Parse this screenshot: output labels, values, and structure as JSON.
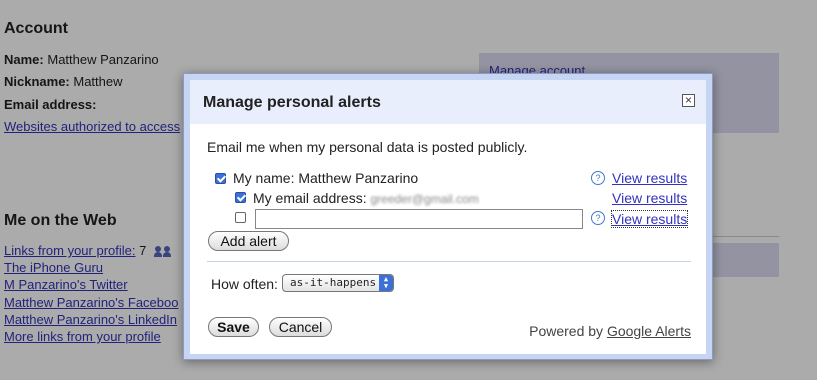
{
  "background": {
    "account_heading": "Account",
    "name_label": "Name:",
    "name_value": "Matthew Panzarino",
    "nickname_label": "Nickname:",
    "nickname_value": "Matthew",
    "email_label": "Email address:",
    "websites_link": "Websites authorized to access",
    "manage_account_link": "Manage account",
    "web_heading": "Me on the Web",
    "links_from_profile": "Links from your profile:",
    "links_count": "7",
    "profile_links": [
      "The iPhone Guru",
      "M Panzarino's Twitter",
      "Matthew Panzarino's Faceboo",
      "Matthew Panzarino's LinkedIn"
    ],
    "more_links": "More links from your profile"
  },
  "dialog": {
    "title": "Manage personal alerts",
    "close_glyph": "×",
    "intro": "Email me when my personal data is posted publicly.",
    "options": [
      {
        "label": "My name: Matthew Panzarino",
        "checked": true,
        "view": "View results"
      },
      {
        "label": "My email address:",
        "blurred_value": "greeder@gmail.com",
        "checked": true,
        "view": "View results"
      },
      {
        "label": "",
        "checked": false,
        "view": "View results"
      }
    ],
    "add_alert_button": "Add alert",
    "how_often_label": "How often:",
    "how_often_value": "as-it-happens",
    "save_button": "Save",
    "cancel_button": "Cancel",
    "powered_by": "Powered by",
    "powered_link": "Google Alerts",
    "help_glyph": "?"
  },
  "colors": {
    "link": "#3333bb",
    "dialog_frame": "#c6d5f3",
    "checkbox_accent": "#3d6fd8"
  }
}
